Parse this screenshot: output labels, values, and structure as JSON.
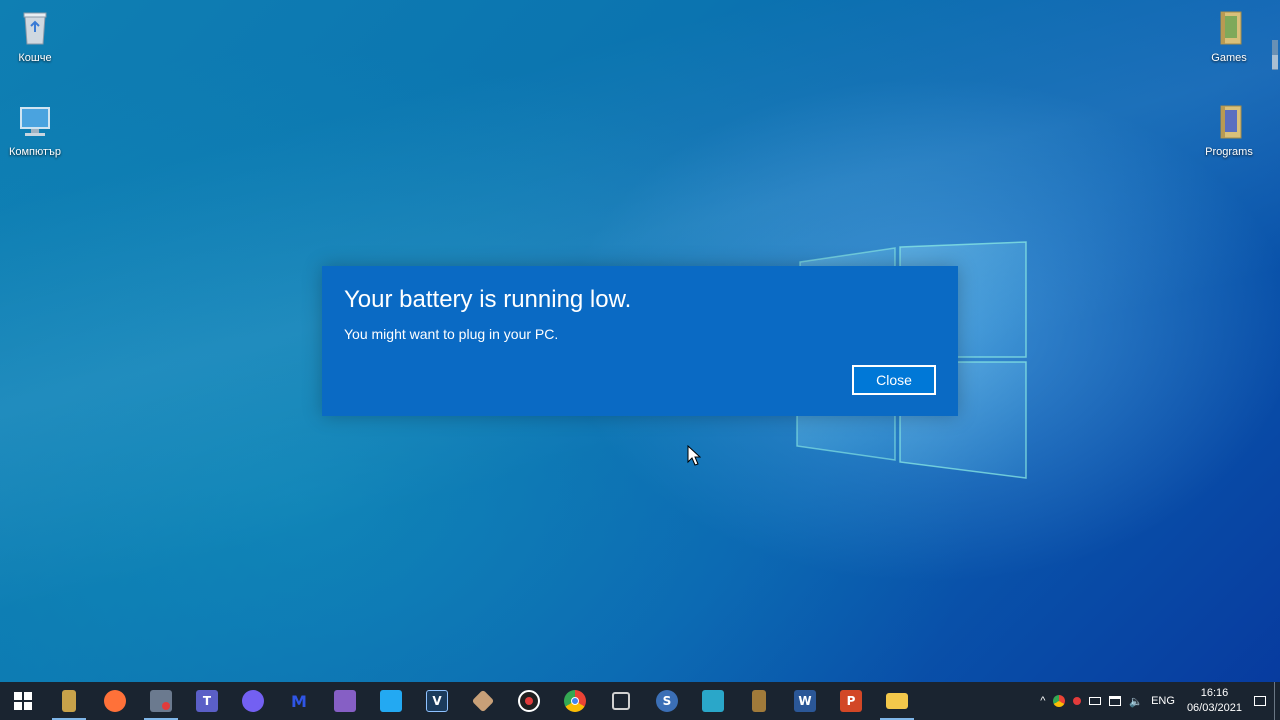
{
  "desktop": {
    "icons_left": [
      {
        "label": "Кошче",
        "icon": "recycle-bin-icon"
      },
      {
        "label": "Компютър",
        "icon": "computer-icon"
      }
    ],
    "icons_right": [
      {
        "label": "Games",
        "icon": "folder-icon"
      },
      {
        "label": "Programs",
        "icon": "folder-icon"
      }
    ]
  },
  "dialog": {
    "title": "Your battery is running low.",
    "message": "You might want to plug in your PC.",
    "close_label": "Close"
  },
  "taskbar": {
    "apps": [
      {
        "name": "start-icon",
        "color": "#ffffff"
      },
      {
        "name": "file-cabinet-icon",
        "color": "#c8a24a"
      },
      {
        "name": "firefox-icon",
        "color": "#ff7139"
      },
      {
        "name": "screen-recorder-icon",
        "color": "#6b7a8f"
      },
      {
        "name": "teams-icon",
        "color": "#5b5fc7"
      },
      {
        "name": "viber-icon",
        "color": "#7360f2"
      },
      {
        "name": "malwarebytes-icon",
        "color": "#1c3fd6"
      },
      {
        "name": "visual-studio-icon",
        "color": "#865fc5"
      },
      {
        "name": "vscode-icon",
        "color": "#23a9f2"
      },
      {
        "name": "vegas-icon",
        "color": "#1b3b5c"
      },
      {
        "name": "tool-icon",
        "color": "#c8a078"
      },
      {
        "name": "obs-icon",
        "color": "#202020"
      },
      {
        "name": "chrome-icon",
        "color": "#34a853"
      },
      {
        "name": "3d-box-icon",
        "color": "#d0d0d0"
      },
      {
        "name": "skype-icon",
        "color": "#3b6fb6"
      },
      {
        "name": "remote-app-icon",
        "color": "#2aa7c9"
      },
      {
        "name": "coffee-icon",
        "color": "#a07a3a"
      },
      {
        "name": "word-icon",
        "color": "#2b5797"
      },
      {
        "name": "powerpoint-icon",
        "color": "#d24726"
      },
      {
        "name": "file-explorer-icon",
        "color": "#f3c84b"
      }
    ],
    "tray": {
      "language": "ENG",
      "time": "16:16",
      "date": "06/03/2021"
    }
  }
}
